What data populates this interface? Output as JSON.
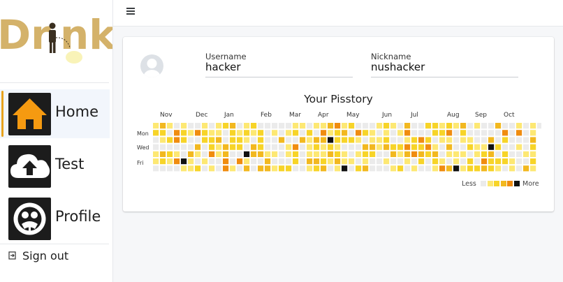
{
  "app": {
    "logo_text": "Drink"
  },
  "sidebar": {
    "items": [
      {
        "label": "Home",
        "icon": "home-icon",
        "active": true
      },
      {
        "label": "Test",
        "icon": "cloud-upload-icon",
        "active": false
      },
      {
        "label": "Profile",
        "icon": "profile-icon",
        "active": false
      }
    ],
    "signout_label": "Sign out"
  },
  "profile": {
    "username_label": "Username",
    "username_value": "hacker",
    "nickname_label": "Nickname",
    "nickname_value": "nushacker"
  },
  "history": {
    "title": "Your Pisstory",
    "months": [
      "Nov",
      "Dec",
      "Jan",
      "Feb",
      "Mar",
      "Apr",
      "May",
      "Jun",
      "Jul",
      "Aug",
      "Sep",
      "Oct"
    ],
    "day_labels": [
      "Mon",
      "Wed",
      "Fri"
    ],
    "legend_less": "Less",
    "legend_more": "More",
    "levels_colors": [
      "#ebebeb",
      "#fde873",
      "#f7d428",
      "#f2b81f",
      "#f08c0f",
      "#111111"
    ],
    "weeks": 56,
    "cell_levels_seed": 7
  }
}
